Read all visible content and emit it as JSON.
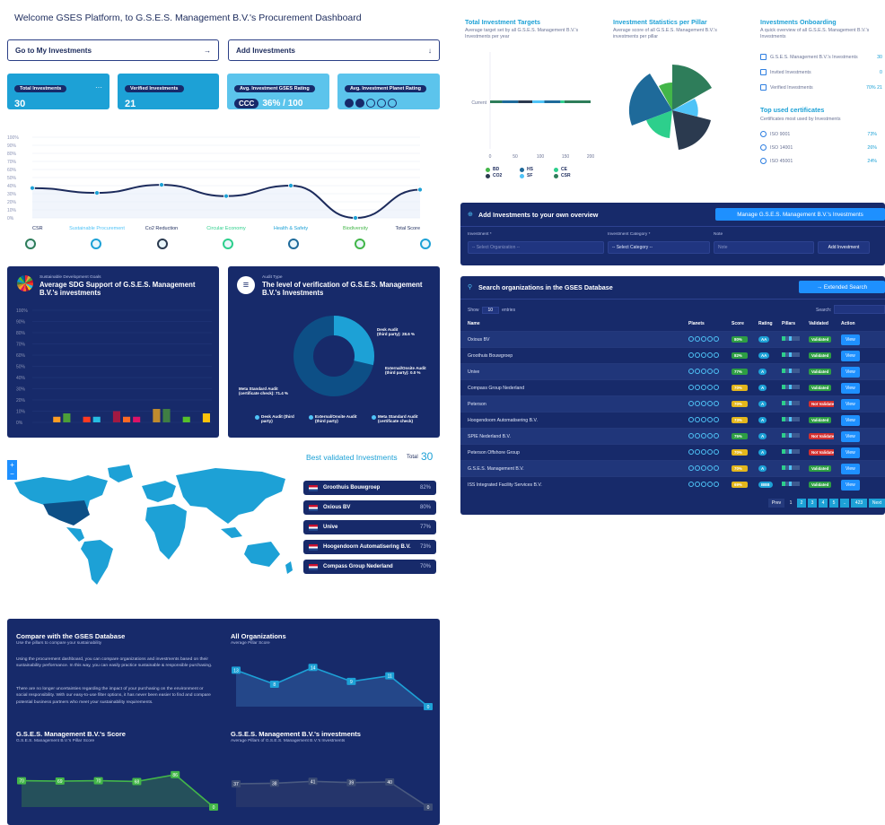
{
  "header": {
    "title": "Welcome GSES Platform, to G.S.E.S. Management B.V.'s Procurement Dashboard"
  },
  "nav": {
    "goto_label": "Go to My Investments",
    "goto_icon": "→",
    "add_label": "Add Investments",
    "add_icon": "↓"
  },
  "stats": {
    "total_label": "Total Investments",
    "total_value": "30",
    "total_menu": "···",
    "verified_label": "Verified Investments",
    "verified_value": "21",
    "gses_label": "Avg. Investment GSES Rating",
    "gses_grade": "CCC",
    "gses_value": "36% / 100",
    "planet_label": "Avg. Investment Planet Rating",
    "planet_rating": 2,
    "planet_max": 5
  },
  "pillar_chart": {
    "yticks": [
      "100%",
      "90%",
      "80%",
      "70%",
      "60%",
      "50%",
      "40%",
      "30%",
      "20%",
      "10%",
      "0%"
    ],
    "labels": [
      "CSR",
      "Sustainable Procurement",
      "Co2 Reduction",
      "Circular Economy",
      "Health & Safety",
      "Biodiversity",
      "Total Score"
    ]
  },
  "sdg": {
    "caption": "Sustainable Development Goals",
    "title": "Average SDG Support of G.S.E.S. Management B.V.'s investments",
    "yticks": [
      "100%",
      "90%",
      "80%",
      "70%",
      "60%",
      "50%",
      "40%",
      "30%",
      "20%",
      "10%",
      "0%"
    ]
  },
  "audit": {
    "caption": "Audit Type",
    "title": "The level of verification of G.S.E.S. Management B.V.'s Investments",
    "label_desk": "Desk Audit\n(third party): 28.6 %",
    "label_ext": "External/Onsite Audit\n(third party): 0.0 %",
    "label_meta": "Meta Standard Audit\n(certificate check): 71.4 %",
    "legend": [
      "Desk Audit (third party)",
      "External/Onsite Audit (third party)",
      "Meta Standard Audit (certificate check)"
    ]
  },
  "map": {
    "zoom_in": "+",
    "zoom_out": "−",
    "best_title": "Best validated Investments",
    "total_label": "Total",
    "total_value": "30",
    "best": [
      {
        "name": "Groothuis Bouwgroep",
        "pct": "82%"
      },
      {
        "name": "Oxious BV",
        "pct": "80%"
      },
      {
        "name": "Unive",
        "pct": "77%"
      },
      {
        "name": "Hoogendoorn Automatisering B.V.",
        "pct": "73%"
      },
      {
        "name": "Compass Group Nederland",
        "pct": "70%"
      }
    ]
  },
  "compare": {
    "title": "Compare with the GSES Database",
    "subtitle": "Use the pillars to compare your sustainability",
    "p1": "Using the procurement dashboard, you can compare organizations and investments based on their sustainability performance. In this way, you can easily practice sustainable & responsible purchasing.",
    "p2": "There are no longer uncertainties regarding the impact of your purchasing on the environment or social responsibility. With our easy-to-use filter options, it has never been easier to find and compare potential business partners who meet your sustainability requirements.",
    "allorg_title": "All Organizations",
    "allorg_sub": "Average Pillar Score",
    "allorg_vals": [
      "13",
      "8",
      "14",
      "9",
      "11",
      "0"
    ],
    "own_title": "G.S.E.S. Management B.V.'s Score",
    "own_sub": "G.S.E.S. Management B.V.'s Pillar Score",
    "own_vals": [
      "70",
      "69",
      "70",
      "68",
      "86",
      "0"
    ],
    "inv_title": "G.S.E.S. Management B.V.'s investments",
    "inv_sub": "Average Pillars of G.S.E.S. Management B.V.'s Investments",
    "inv_vals": [
      "37",
      "38",
      "41",
      "39",
      "40",
      "0"
    ]
  },
  "targets": {
    "title": "Total Investment Targets",
    "subtitle": "Average target set by all G.S.E.S. Management B.V.'s Investments per year",
    "current": "Current",
    "xticks": [
      "0",
      "50",
      "100",
      "150",
      "200"
    ],
    "legend": [
      {
        "k": "BD",
        "c": "#43b649"
      },
      {
        "k": "HS",
        "c": "#1e6a9a"
      },
      {
        "k": "CE",
        "c": "#2dcf8c"
      },
      {
        "k": "CO2",
        "c": "#2b3a4f"
      },
      {
        "k": "SF",
        "c": "#4fc3f7"
      },
      {
        "k": "CSR",
        "c": "#2e7d5a"
      }
    ]
  },
  "pillarstats": {
    "title": "Investment Statistics per Pillar",
    "subtitle": "Average score of all G.S.E.S. Management B.V.'s investments per pillar"
  },
  "onboarding": {
    "title": "Investments Onboarding",
    "subtitle": "A quick overview of all G.S.E.S. Management B.V.'s Investments",
    "items": [
      {
        "label": "G.S.E.S. Management B.V.'s Investments",
        "val": "30"
      },
      {
        "label": "Invited Investments",
        "val": "0"
      },
      {
        "label": "Verified Investments",
        "val": "70%  21"
      }
    ]
  },
  "certs": {
    "title": "Top used certificates",
    "subtitle": "Certificates most used by Investments",
    "items": [
      {
        "label": "ISO 9001",
        "val": "73%"
      },
      {
        "label": "ISO 14001",
        "val": "26%"
      },
      {
        "label": "ISO 45001",
        "val": "24%"
      }
    ]
  },
  "addinv": {
    "title": "Add Investments to your own overview",
    "manage": "Manage G.S.E.S. Management B.V.'s Investments",
    "inv_label": "Investment *",
    "inv_ph": "-- Select Organization --",
    "cat_label": "Investment Category *",
    "cat_ph": "-- Select Category --",
    "note_label": "Note",
    "note_ph": "Note",
    "btn": "Add Investment"
  },
  "search": {
    "title": "Search organizations in the GSES Database",
    "ext": "→ Extended Search",
    "show": "Show",
    "entries": "entries",
    "page_len": "10",
    "search_label": "Search:",
    "cols": [
      "Name",
      "Planets",
      "Score",
      "Rating",
      "Pillars",
      "Validated",
      "Action"
    ],
    "rows": [
      {
        "name": "Oxious BV",
        "score": "80%",
        "rating": "AA",
        "val": "Validated",
        "ok": true,
        "sc": "#2e9e44"
      },
      {
        "name": "Groothuis Bouwgroep",
        "score": "82%",
        "rating": "AA",
        "val": "Validated",
        "ok": true,
        "sc": "#2e9e44"
      },
      {
        "name": "Unive",
        "score": "77%",
        "rating": "A",
        "val": "Validated",
        "ok": true,
        "sc": "#2e9e44"
      },
      {
        "name": "Compass Group Nederland",
        "score": "70%",
        "rating": "A",
        "val": "Validated",
        "ok": true,
        "sc": "#e3b61c"
      },
      {
        "name": "Peterson",
        "score": "70%",
        "rating": "A",
        "val": "Not Validated",
        "ok": false,
        "sc": "#e3b61c"
      },
      {
        "name": "Hoogendoorn Automatisering B.V.",
        "score": "73%",
        "rating": "A",
        "val": "Validated",
        "ok": true,
        "sc": "#e3b61c"
      },
      {
        "name": "SPIE Nederland B.V.",
        "score": "75%",
        "rating": "A",
        "val": "Not Validated",
        "ok": false,
        "sc": "#2e9e44"
      },
      {
        "name": "Peterson Offshore Group",
        "score": "70%",
        "rating": "A",
        "val": "Not Validated",
        "ok": false,
        "sc": "#e3b61c"
      },
      {
        "name": "G.S.E.S. Management B.V.",
        "score": "70%",
        "rating": "A",
        "val": "Validated",
        "ok": true,
        "sc": "#e3b61c"
      },
      {
        "name": "ISS Integrated Facility Services B.V.",
        "score": "69%",
        "rating": "BBB",
        "val": "Validated",
        "ok": true,
        "sc": "#e3b61c"
      }
    ],
    "view": "View",
    "prev": "Prev",
    "next": "Next",
    "pages": [
      "1",
      "2",
      "3",
      "4",
      "5",
      "..",
      "423"
    ]
  },
  "colors": {
    "navy": "#172a6a",
    "blue": "#1da1d6",
    "accent": "#1e90ff",
    "green": "#43b649"
  }
}
